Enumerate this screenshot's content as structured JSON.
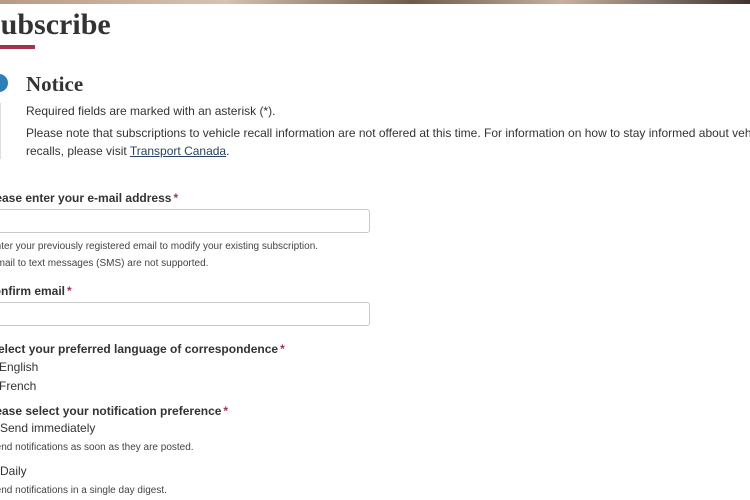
{
  "page": {
    "title": "Subscribe"
  },
  "notice": {
    "title": "Notice",
    "required_text": "Required fields are marked with an asterisk (*).",
    "recall_text_line1": "Please note that subscriptions to vehicle recall information are not offered at this time. For information on how to stay informed about vehicle",
    "recall_text_line2_prefix": "recalls, please visit ",
    "recall_link": "Transport Canada",
    "recall_text_line2_suffix": "."
  },
  "form": {
    "required_marker": "*",
    "email": {
      "label": "Please enter your e-mail address",
      "value": "",
      "help_1": "Enter your previously registered email to modify your existing subscription.",
      "help_2": "Email to text messages (SMS) are not supported."
    },
    "confirm_email": {
      "label": "Confirm email",
      "value": ""
    },
    "language": {
      "label": "Select your preferred language of correspondence",
      "options": [
        "English",
        "French"
      ]
    },
    "notification": {
      "label": "Please select your notification preference",
      "options": [
        {
          "label": "Send immediately",
          "help": "Send notifications as soon as they are posted."
        },
        {
          "label": "Daily",
          "help": "Send notifications in a single day digest."
        }
      ]
    }
  }
}
